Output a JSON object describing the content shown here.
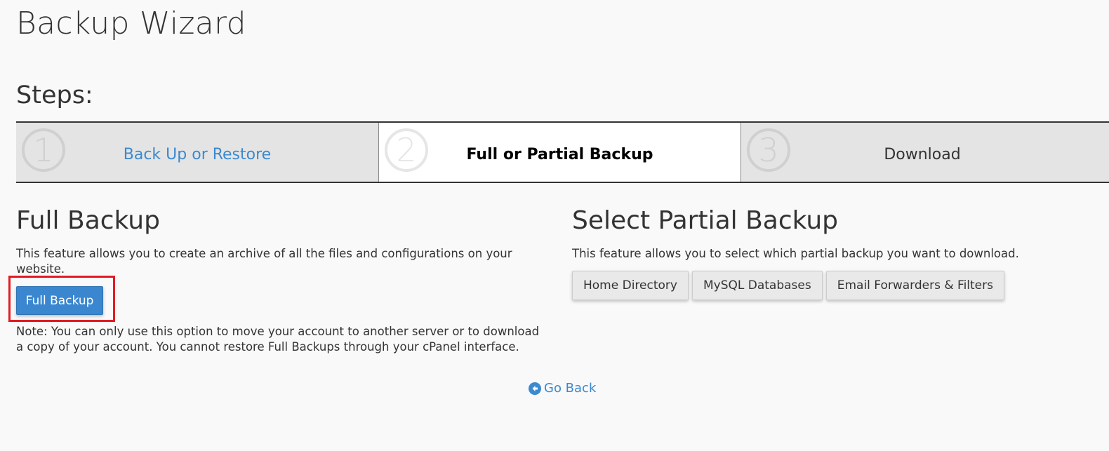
{
  "page": {
    "title": "Backup Wizard",
    "steps_heading": "Steps:"
  },
  "steps": [
    {
      "number": "1",
      "label": "Back Up or Restore",
      "state": "link"
    },
    {
      "number": "2",
      "label": "Full or Partial Backup",
      "state": "active"
    },
    {
      "number": "3",
      "label": "Download",
      "state": "inactive"
    }
  ],
  "full_backup": {
    "heading": "Full Backup",
    "description": "This feature allows you to create an archive of all the files and configurations on your website.",
    "button_label": "Full Backup",
    "note": "Note: You can only use this option to move your account to another server or to download a copy of your account. You cannot restore Full Backups through your cPanel interface."
  },
  "partial_backup": {
    "heading": "Select Partial Backup",
    "description": "This feature allows you to select which partial backup you want to download.",
    "buttons": [
      {
        "label": "Home Directory"
      },
      {
        "label": "MySQL Databases"
      },
      {
        "label": "Email Forwarders & Filters"
      }
    ]
  },
  "footer": {
    "go_back_label": "Go Back",
    "go_back_icon": "arrow-circle-left-icon"
  },
  "colors": {
    "link": "#3b89d0",
    "primary_button": "#3a87d0",
    "highlight": "#e21b23"
  }
}
